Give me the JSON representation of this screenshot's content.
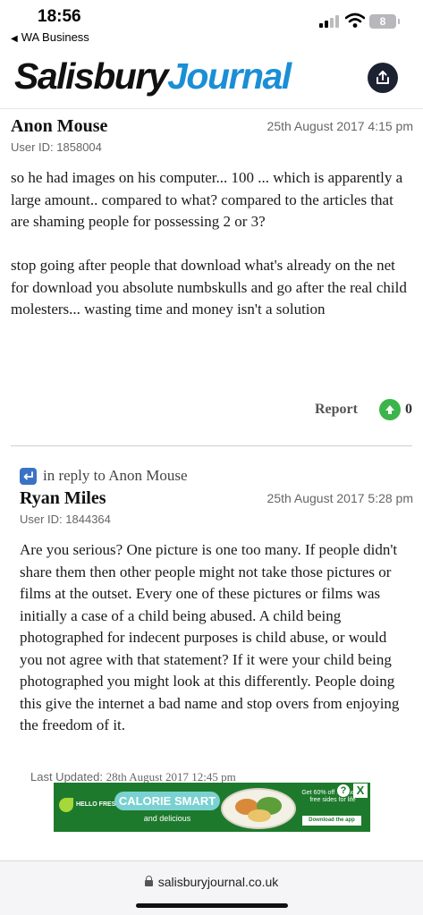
{
  "status_bar": {
    "time": "18:56",
    "back_app": "WA Business",
    "battery": "8"
  },
  "site": {
    "logo_part1": "Salisbury",
    "logo_part2": "Journal",
    "brand_color": "#1a8fd6"
  },
  "comments": [
    {
      "author": "Anon Mouse",
      "date": "25th August 2017 4:15 pm",
      "user_id": "User ID: 1858004",
      "paragraphs": [
        "so he had images on his computer... 100 ... which is apparently a large amount.. compared to what? compared to the articles that are shaming people for possessing 2 or 3?",
        "stop going after people that download what's already on the net for download you absolute numbskulls and go after the real child molesters... wasting time and money isn't a solution"
      ],
      "report_label": "Report",
      "votes": "0"
    },
    {
      "reply_prefix": "in reply to Anon Mouse",
      "author": "Ryan Miles",
      "date": "25th August 2017 5:28 pm",
      "user_id": "User ID: 1844364",
      "paragraphs": [
        "Are you serious? One picture is one too many. If people didn't share them then other people might not take those pictures or films at the outset. Every one of these pictures or films was initially a case of a child being abused. A child being photographed for indecent purposes is child abuse, or would you not agree with that statement? If it were your child being photographed you might look at this differently. People doing this give the internet a bad name and stop overs from enjoying the freedom of it."
      ]
    }
  ],
  "last_updated": {
    "label": "Last Updated:",
    "value": "28th August 2017 12:45 pm"
  },
  "ad": {
    "brand": "HELLO FRESH",
    "headline": "CALORIE SMART",
    "subline": "and delicious",
    "offer": "Get 60% off first box + free sides for life",
    "cta": "Download the app",
    "info_icon": "?",
    "close_icon": "X"
  },
  "browser": {
    "url": "salisburyjournal.co.uk"
  },
  "icons": [
    "chevron-left-icon",
    "signal-icon",
    "wifi-icon",
    "battery-icon",
    "share-icon",
    "upvote-icon",
    "reply-icon",
    "lock-icon",
    "ad-info-icon",
    "ad-close-icon"
  ]
}
